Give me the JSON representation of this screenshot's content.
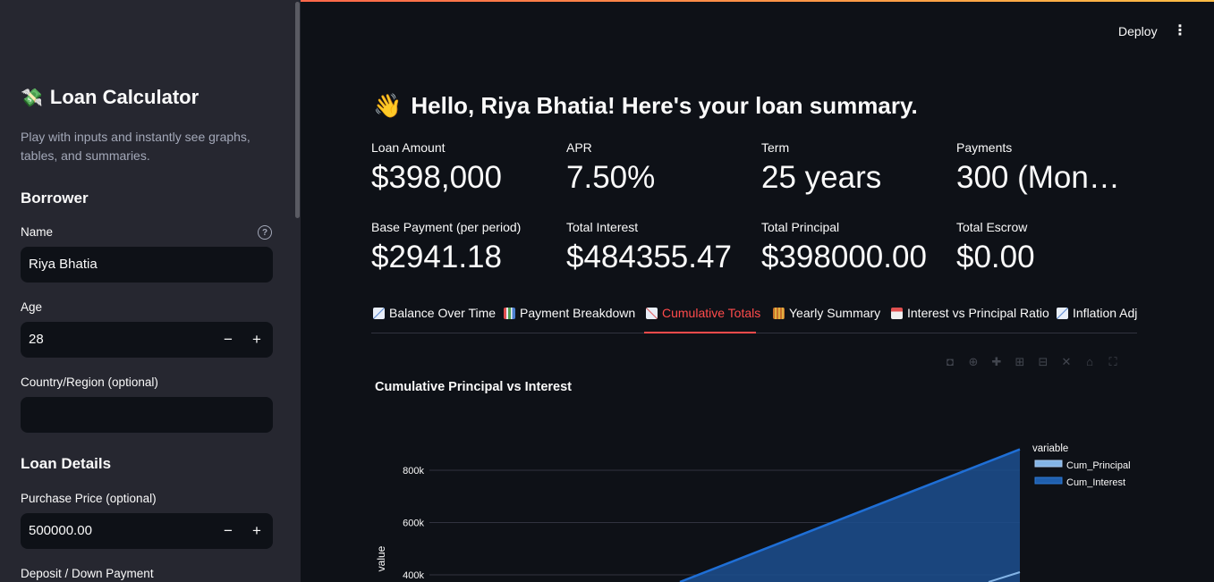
{
  "sidebar": {
    "title": "Loan Calculator",
    "title_icon": "money-with-wings-icon",
    "subtitle": "Play with inputs and instantly see graphs, tables, and summaries.",
    "sections": {
      "borrower": "Borrower",
      "loan_details": "Loan Details"
    },
    "fields": {
      "name_label": "Name",
      "name_value": "Riya Bhatia",
      "age_label": "Age",
      "age_value": "28",
      "country_label": "Country/Region (optional)",
      "country_value": "",
      "purchase_label": "Purchase Price (optional)",
      "purchase_value": "500000.00",
      "deposit_label": "Deposit / Down Payment"
    }
  },
  "header": {
    "deploy": "Deploy",
    "menu": "⋮"
  },
  "main": {
    "greeting_emoji": "👋",
    "greeting": "Hello, Riya Bhatia! Here's your loan summary.",
    "metrics": [
      {
        "label": "Loan Amount",
        "value": "$398,000"
      },
      {
        "label": "APR",
        "value": "7.50%"
      },
      {
        "label": "Term",
        "value": "25 years"
      },
      {
        "label": "Payments",
        "value": "300 (Mont…"
      },
      {
        "label": "Base Payment (per period)",
        "value": "$2941.18"
      },
      {
        "label": "Total Interest",
        "value": "$484355.47"
      },
      {
        "label": "Total Principal",
        "value": "$398000.00"
      },
      {
        "label": "Total Escrow",
        "value": "$0.00"
      }
    ],
    "tabs": [
      {
        "label": "Balance Over Time",
        "icon": "chart-decreasing-icon"
      },
      {
        "label": "Payment Breakdown",
        "icon": "bar-chart-icon"
      },
      {
        "label": "Cumulative Totals",
        "icon": "chart-increasing-icon"
      },
      {
        "label": "Yearly Summary",
        "icon": "abacus-icon"
      },
      {
        "label": "Interest vs Principal Ratio",
        "icon": "calendar-icon"
      },
      {
        "label": "Inflation Adj",
        "icon": "chart-decreasing-icon"
      }
    ],
    "active_tab": "Cumulative Totals"
  },
  "chart_data": {
    "type": "area",
    "title": "Cumulative Principal vs Interest",
    "ylabel": "value",
    "legend_title": "variable",
    "legend_position": "top-right",
    "y_ticks": [
      "800k",
      "600k",
      "400k"
    ],
    "series": [
      {
        "name": "Cum_Principal",
        "color": "#83b4e6"
      },
      {
        "name": "Cum_Interest",
        "color": "#1f5fae"
      }
    ],
    "visible_points": {
      "total_end": 880000
    }
  },
  "colors": {
    "accent": "#ff4b4b",
    "sidebar_bg": "#262730",
    "main_bg": "#0e1117"
  }
}
